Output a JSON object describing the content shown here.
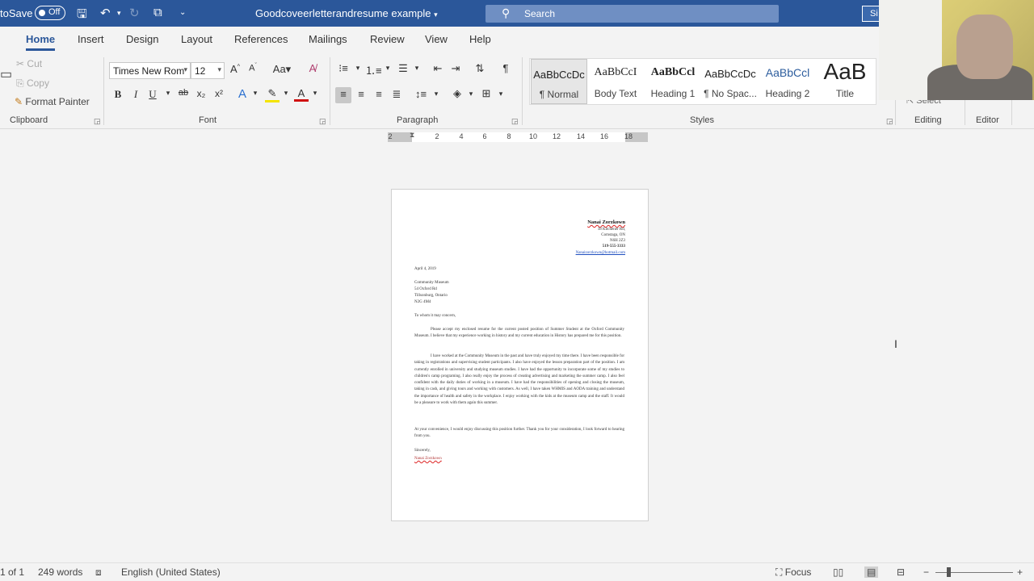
{
  "titlebar": {
    "autosave_label": "toSave",
    "toggle_label": "Off",
    "doc_title": "Goodcoveerletterandresume example",
    "search_placeholder": "Search",
    "signin_label": "Si"
  },
  "tabs": [
    "Home",
    "Insert",
    "Design",
    "Layout",
    "References",
    "Mailings",
    "Review",
    "View",
    "Help"
  ],
  "ribbon": {
    "clipboard": {
      "cut": "Cut",
      "copy": "Copy",
      "format_painter": "Format Painter",
      "label": "Clipboard"
    },
    "font": {
      "family": "Times New Rom",
      "size": "12",
      "label": "Font",
      "bold": "B",
      "italic": "I",
      "underline": "U"
    },
    "paragraph": {
      "label": "Paragraph"
    },
    "styles": {
      "label": "Styles",
      "items": [
        {
          "preview": "AaBbCcDc",
          "name": "¶ Normal"
        },
        {
          "preview": "AaBbCcI",
          "name": "Body Text"
        },
        {
          "preview": "AaBbCcl",
          "name": "Heading 1"
        },
        {
          "preview": "AaBbCcDc",
          "name": "¶ No Spac..."
        },
        {
          "preview": "AaBbCcl",
          "name": "Heading 2"
        },
        {
          "preview": "AaB",
          "name": "Title"
        }
      ]
    },
    "editing": {
      "label": "Editing",
      "select": "Select"
    },
    "editor": {
      "label": "Editor"
    }
  },
  "ruler": {
    "numbers": [
      "2",
      "2",
      "4",
      "6",
      "8",
      "10",
      "12",
      "14",
      "16",
      "18"
    ]
  },
  "letter": {
    "name": "Nanai Zorzkown",
    "address1": "18 Kitchener Rd,",
    "address2": "Comstaga, ON",
    "address3": "N6H 2Z3",
    "phone": "519-555-3333",
    "email": "Nanaizorzkown@hotmail.com",
    "date": "April 4, 2019",
    "recipient1": "Community Museum",
    "recipient2": "54 Oxford Rd",
    "recipient3": "Tillsonburg, Ontario",
    "recipient4": "N2G 4M4",
    "salutation": "To whom it may concern,",
    "para1": "Please accept my enclosed resume for the current posted position of Summer Student at the Oxford Community Museum. I believe that my experience working in history and my current education in History has prepared me for this position.",
    "para2": "I have worked at the Community Museum in the past and have truly enjoyed my time there. I have been responsible for taking in registrations and supervising student participants. I also have enjoyed the lesson preparation part of the position. I am currently enrolled in university and studying museum studies. I have had the opportunity to incorporate some of my studies to children's camp programing. I also really enjoy the process of creating advertising and marketing the summer camp. I also feel confident with the daily duties of working in a museum. I have had the responsibilities of opening and closing the museum, taking in cash, and giving tours and working with customers. As well, I have taken WHMIS and AODA training and understand the importance of health and safety in the workplace. I enjoy working with the kids at the museum camp and the staff. It would be a pleasure to work with them again this summer.",
    "para3": "At your convenience, I would enjoy discussing this position further. Thank you for your consideration, I look forward to hearing from you.",
    "closing": "Sincerely,",
    "signature": "Nanai Zorzkown"
  },
  "statusbar": {
    "page": "1 of 1",
    "words": "249 words",
    "language": "English (United States)",
    "focus": "Focus",
    "zoom_minus": "−",
    "zoom_plus": "+"
  }
}
